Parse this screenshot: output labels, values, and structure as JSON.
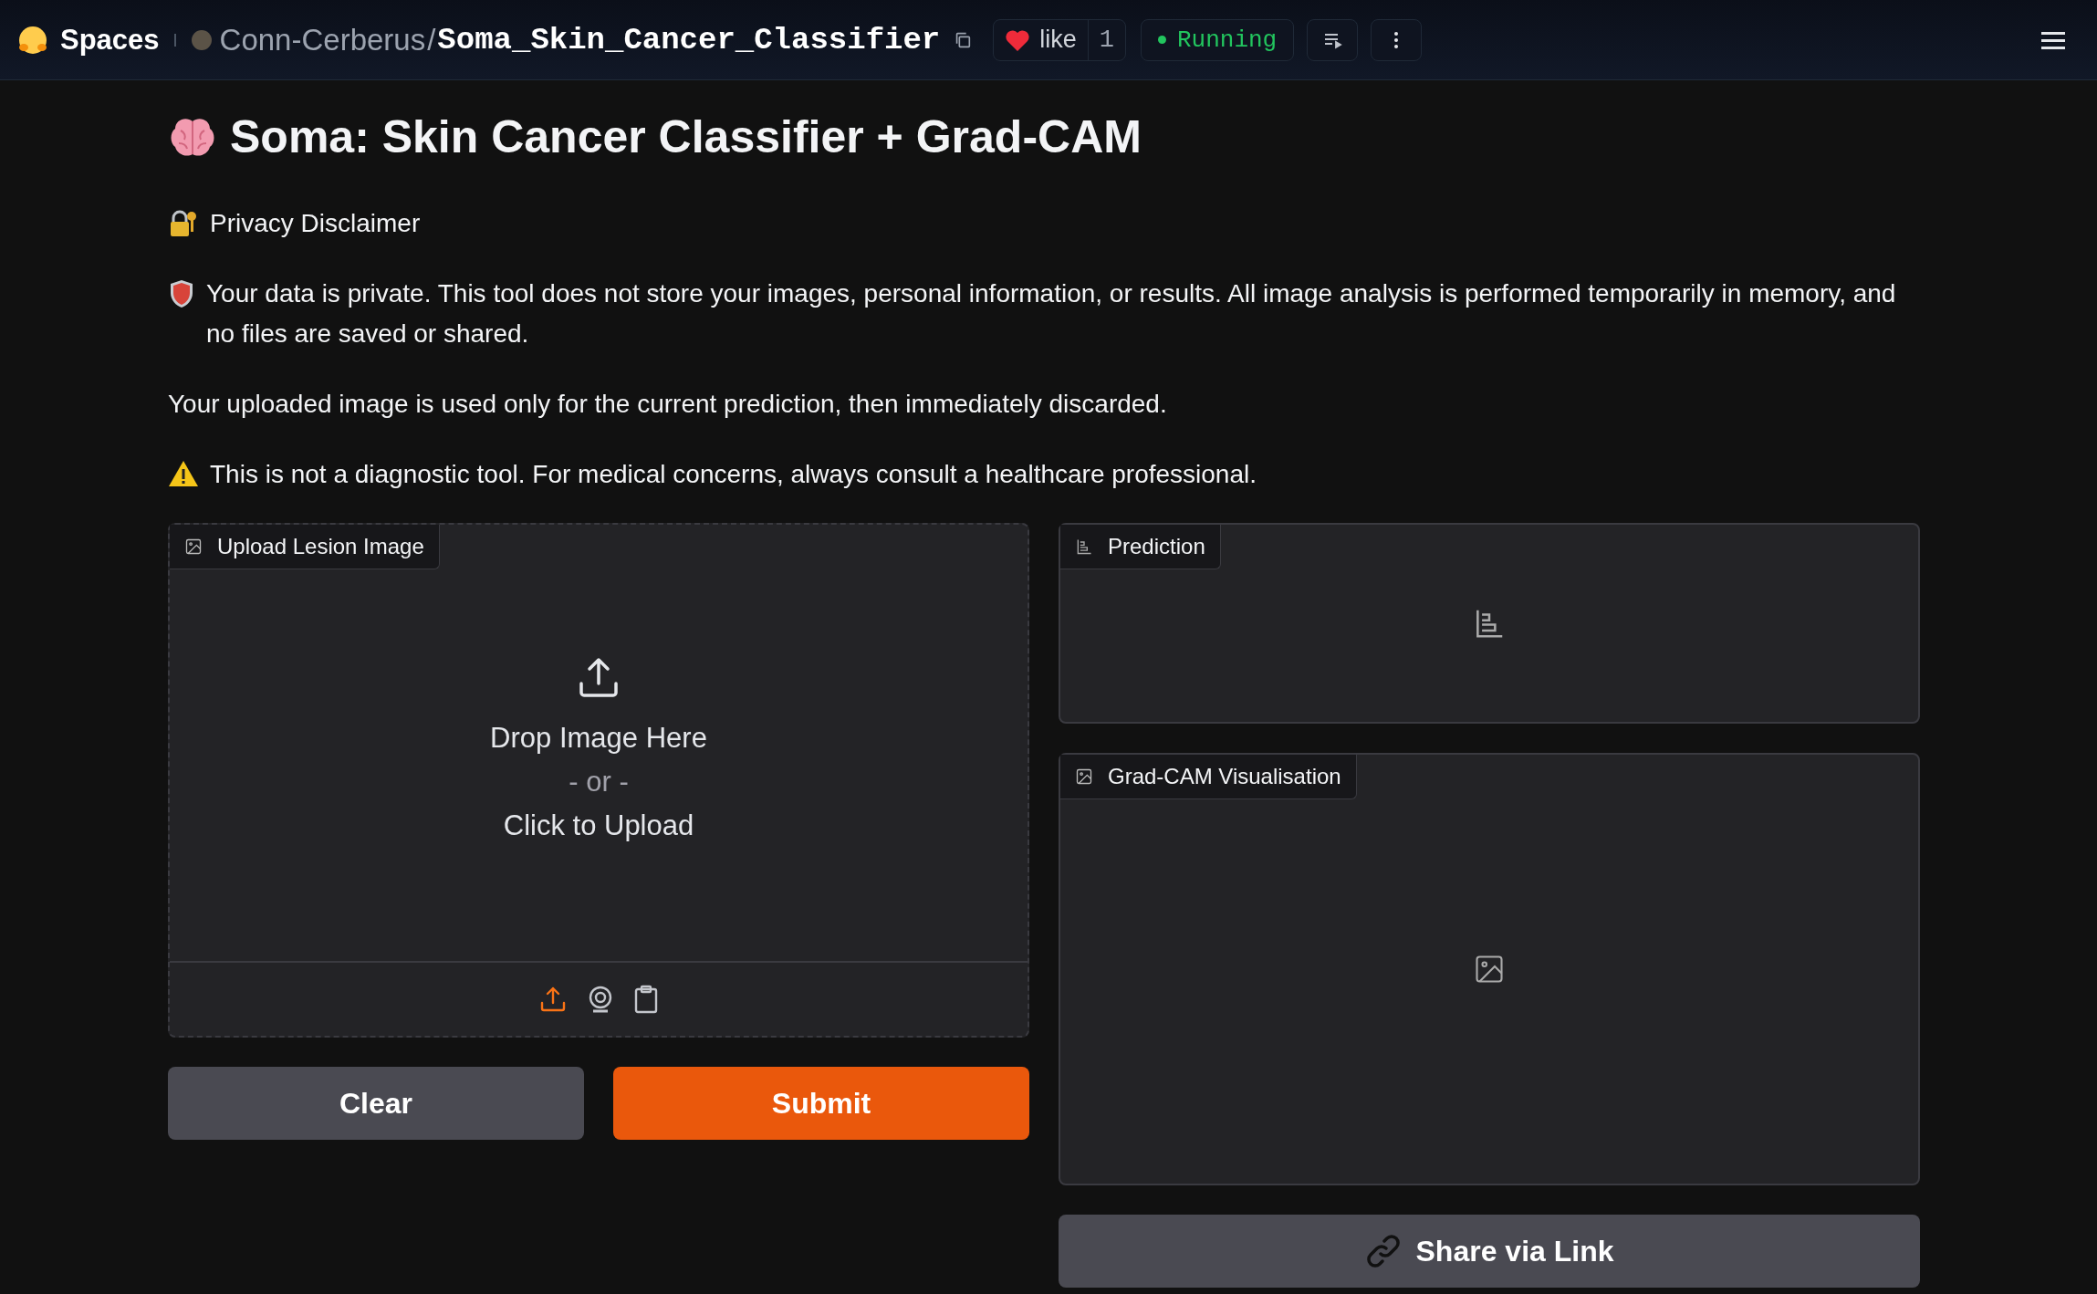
{
  "header": {
    "brand": "Spaces",
    "owner": "Conn-Cerberus",
    "separator": "/",
    "repo": "Soma_Skin_Cancer_Classifier",
    "like": {
      "label": "like",
      "count": "1",
      "liked": true
    },
    "status": {
      "label": "Running",
      "kind": "running"
    }
  },
  "title": "Soma: Skin Cancer Classifier + Grad-CAM",
  "disclaimer": [
    {
      "kind": "lock",
      "text": "Privacy Disclaimer"
    },
    {
      "kind": "shield",
      "text": "Your data is private. This tool does not store your images, personal information, or results. All image analysis is performed temporarily in memory, and no files are saved or shared."
    },
    {
      "kind": "plain",
      "text": "Your uploaded image is used only for the current prediction, then immediately discarded."
    },
    {
      "kind": "warning",
      "text": "This is not a diagnostic tool. For medical concerns, always consult a healthcare professional."
    }
  ],
  "upload": {
    "label": "Upload Lesion Image",
    "drop": "Drop Image Here",
    "or": "- or -",
    "click": "Click to Upload",
    "sources": [
      {
        "kind": "upload",
        "selected": true
      },
      {
        "kind": "webcam",
        "selected": false
      },
      {
        "kind": "clipboard",
        "selected": false
      }
    ]
  },
  "buttons": [
    {
      "label": "Clear",
      "kind": "secondary"
    },
    {
      "label": "Submit",
      "kind": "primary"
    }
  ],
  "prediction": {
    "label": "Prediction"
  },
  "gradcam": {
    "label": "Grad-CAM Visualisation"
  },
  "share": {
    "label": "Share via Link"
  }
}
